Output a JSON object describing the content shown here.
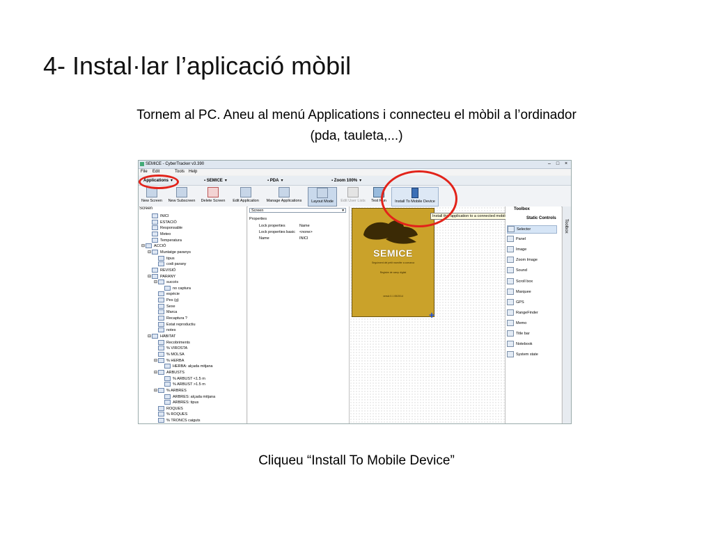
{
  "slide": {
    "title": "4- Instal·lar l’aplicació mòbil",
    "instruction_line1": "Tornem al PC. Aneu al menú Applications i connecteu el mòbil a l’ordinador",
    "instruction_line2": "(pda, tauleta,...)",
    "caption": "Cliqueu “Install To Mobile Device”"
  },
  "app": {
    "window_title": "SEMICE - CyberTracker v3.390",
    "menu": [
      "File",
      "Edit",
      "Tools",
      "Help"
    ],
    "combos": [
      "Applications",
      "SEMICE",
      "PDA",
      "Zoom 100%"
    ],
    "toolbar": [
      "New Screen",
      "New Subscreen",
      "Delete Screen",
      "Edit Application",
      "Manage Applications",
      "Layout Mode",
      "Edit User Lists",
      "Test Run",
      "Install To Mobile Device"
    ],
    "tooltip": "Install this application to a connected mobile device",
    "tree_header": "Screen",
    "tree": [
      {
        "label": "INICI",
        "level": 1,
        "pm": ""
      },
      {
        "label": "ESTACIÓ",
        "level": 1,
        "pm": ""
      },
      {
        "label": "Responsable",
        "level": 1,
        "pm": ""
      },
      {
        "label": "Meteo",
        "level": 1,
        "pm": ""
      },
      {
        "label": "Temperatura",
        "level": 1,
        "pm": ""
      },
      {
        "label": "ACCIÓ",
        "level": 0,
        "pm": "⊟"
      },
      {
        "label": "Muntatge paranys",
        "level": 1,
        "pm": "⊟"
      },
      {
        "label": "tipus",
        "level": 2,
        "pm": ""
      },
      {
        "label": "codi parany",
        "level": 2,
        "pm": ""
      },
      {
        "label": "REVISIÓ",
        "level": 1,
        "pm": ""
      },
      {
        "label": "PARANY",
        "level": 1,
        "pm": "⊟"
      },
      {
        "label": "succés",
        "level": 2,
        "pm": "⊟"
      },
      {
        "label": "no captura",
        "level": 3,
        "pm": ""
      },
      {
        "label": "espècie",
        "level": 2,
        "pm": ""
      },
      {
        "label": "Pes (g)",
        "level": 2,
        "pm": ""
      },
      {
        "label": "Sexe",
        "level": 2,
        "pm": ""
      },
      {
        "label": "Marca",
        "level": 2,
        "pm": ""
      },
      {
        "label": "Recaptura ?",
        "level": 2,
        "pm": ""
      },
      {
        "label": "Estat reproductiu",
        "level": 2,
        "pm": ""
      },
      {
        "label": "notes",
        "level": 2,
        "pm": ""
      },
      {
        "label": "HÀBITAT",
        "level": 1,
        "pm": "⊟"
      },
      {
        "label": "Recobriments",
        "level": 2,
        "pm": ""
      },
      {
        "label": "% VIROSTA",
        "level": 2,
        "pm": ""
      },
      {
        "label": "% MOLSA",
        "level": 2,
        "pm": ""
      },
      {
        "label": "% HERBA",
        "level": 2,
        "pm": "⊟"
      },
      {
        "label": "HERBA: alçada mitjana",
        "level": 3,
        "pm": ""
      },
      {
        "label": "ARBUSTS",
        "level": 2,
        "pm": "⊟"
      },
      {
        "label": "% ARBUST <1.5 m",
        "level": 3,
        "pm": ""
      },
      {
        "label": "% ARBUST >1.5 m",
        "level": 3,
        "pm": ""
      },
      {
        "label": "% ARBRES",
        "level": 2,
        "pm": "⊟"
      },
      {
        "label": "ARBRES: alçada mitjana",
        "level": 3,
        "pm": ""
      },
      {
        "label": "ARBRES: tipus",
        "level": 3,
        "pm": ""
      },
      {
        "label": "ROQUES",
        "level": 2,
        "pm": ""
      },
      {
        "label": "% ROQUES",
        "level": 2,
        "pm": ""
      },
      {
        "label": "% TRONCS caiguts",
        "level": 2,
        "pm": ""
      }
    ],
    "props_select": "Screen",
    "props_header": "Properties",
    "props": [
      {
        "name": "Lock properties",
        "value": "Name"
      },
      {
        "name": "Lock properties basic",
        "value": "<none>"
      },
      {
        "name": "Name",
        "value": "INICI"
      }
    ],
    "phone": {
      "brand": "SEMICE",
      "line1": "Seguiment del petit mamífer a comarca",
      "line2": "Registre de camp digital",
      "line3": "versió 0.1  05/2014"
    },
    "toolbox_title": "Toolbox",
    "toolbox_section": "Static Controls",
    "toolbox_tab": "Toolbox",
    "tools": [
      "Selector",
      "Panel",
      "Image",
      "Zoom Image",
      "Sound",
      "Scroll box",
      "Marquee",
      "GPS",
      "RangeFinder",
      "Memo",
      "Title bar",
      "Notebook",
      "System state"
    ]
  },
  "colors": {
    "highlight_ring": "#e2231a",
    "phone_bg": "#caa22a",
    "plus_cursor": "#1d4ed8"
  }
}
